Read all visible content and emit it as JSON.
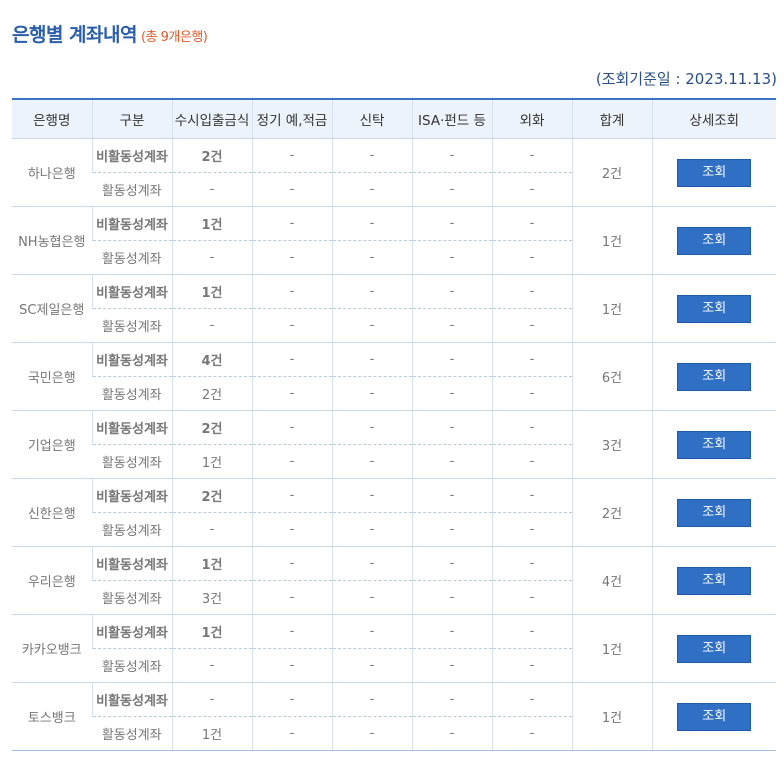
{
  "page": {
    "title": "은행별 계좌내역",
    "count_label": "(총 9개은행)",
    "query_date_label": "(조회기준일 : 2023.11.13)"
  },
  "table": {
    "headers": [
      "은행명",
      "구분",
      "수시입출금식",
      "정기 예,적금",
      "신탁",
      "ISA·펀드 등",
      "외화",
      "합계",
      "상세조회"
    ],
    "view_button_label": "조회",
    "banks": [
      {
        "name": "하나은행",
        "total": "2건",
        "rows": [
          {
            "type": "비활동성계좌",
            "values": [
              "2건",
              "-",
              "-",
              "-",
              "-"
            ]
          },
          {
            "type": "활동성계좌",
            "values": [
              "-",
              "-",
              "-",
              "-",
              "-"
            ]
          }
        ]
      },
      {
        "name": "NH농협은행",
        "total": "1건",
        "rows": [
          {
            "type": "비활동성계좌",
            "values": [
              "1건",
              "-",
              "-",
              "-",
              "-"
            ]
          },
          {
            "type": "활동성계좌",
            "values": [
              "-",
              "-",
              "-",
              "-",
              "-"
            ]
          }
        ]
      },
      {
        "name": "SC제일은행",
        "total": "1건",
        "rows": [
          {
            "type": "비활동성계좌",
            "values": [
              "1건",
              "-",
              "-",
              "-",
              "-"
            ]
          },
          {
            "type": "활동성계좌",
            "values": [
              "-",
              "-",
              "-",
              "-",
              "-"
            ]
          }
        ]
      },
      {
        "name": "국민은행",
        "total": "6건",
        "rows": [
          {
            "type": "비활동성계좌",
            "values": [
              "4건",
              "-",
              "-",
              "-",
              "-"
            ]
          },
          {
            "type": "활동성계좌",
            "values": [
              "2건",
              "-",
              "-",
              "-",
              "-"
            ]
          }
        ]
      },
      {
        "name": "기업은행",
        "total": "3건",
        "rows": [
          {
            "type": "비활동성계좌",
            "values": [
              "2건",
              "-",
              "-",
              "-",
              "-"
            ]
          },
          {
            "type": "활동성계좌",
            "values": [
              "1건",
              "-",
              "-",
              "-",
              "-"
            ]
          }
        ]
      },
      {
        "name": "신한은행",
        "total": "2건",
        "rows": [
          {
            "type": "비활동성계좌",
            "values": [
              "2건",
              "-",
              "-",
              "-",
              "-"
            ]
          },
          {
            "type": "활동성계좌",
            "values": [
              "-",
              "-",
              "-",
              "-",
              "-"
            ]
          }
        ]
      },
      {
        "name": "우리은행",
        "total": "4건",
        "rows": [
          {
            "type": "비활동성계좌",
            "values": [
              "1건",
              "-",
              "-",
              "-",
              "-"
            ]
          },
          {
            "type": "활동성계좌",
            "values": [
              "3건",
              "-",
              "-",
              "-",
              "-"
            ]
          }
        ]
      },
      {
        "name": "카카오뱅크",
        "total": "1건",
        "rows": [
          {
            "type": "비활동성계좌",
            "values": [
              "1건",
              "-",
              "-",
              "-",
              "-"
            ]
          },
          {
            "type": "활동성계좌",
            "values": [
              "-",
              "-",
              "-",
              "-",
              "-"
            ]
          }
        ]
      },
      {
        "name": "토스뱅크",
        "total": "1건",
        "rows": [
          {
            "type": "비활동성계좌",
            "values": [
              "-",
              "-",
              "-",
              "-",
              "-"
            ]
          },
          {
            "type": "활동성계좌",
            "values": [
              "1건",
              "-",
              "-",
              "-",
              "-"
            ]
          }
        ]
      }
    ]
  },
  "colors": {
    "title": "#2a5ea8",
    "count": "#e05b2a",
    "header_bg": "#edf3fb",
    "header_top_border": "#3b73c4",
    "inactive_text": "#2c64b8",
    "button_bg": "#2f6fc4"
  }
}
